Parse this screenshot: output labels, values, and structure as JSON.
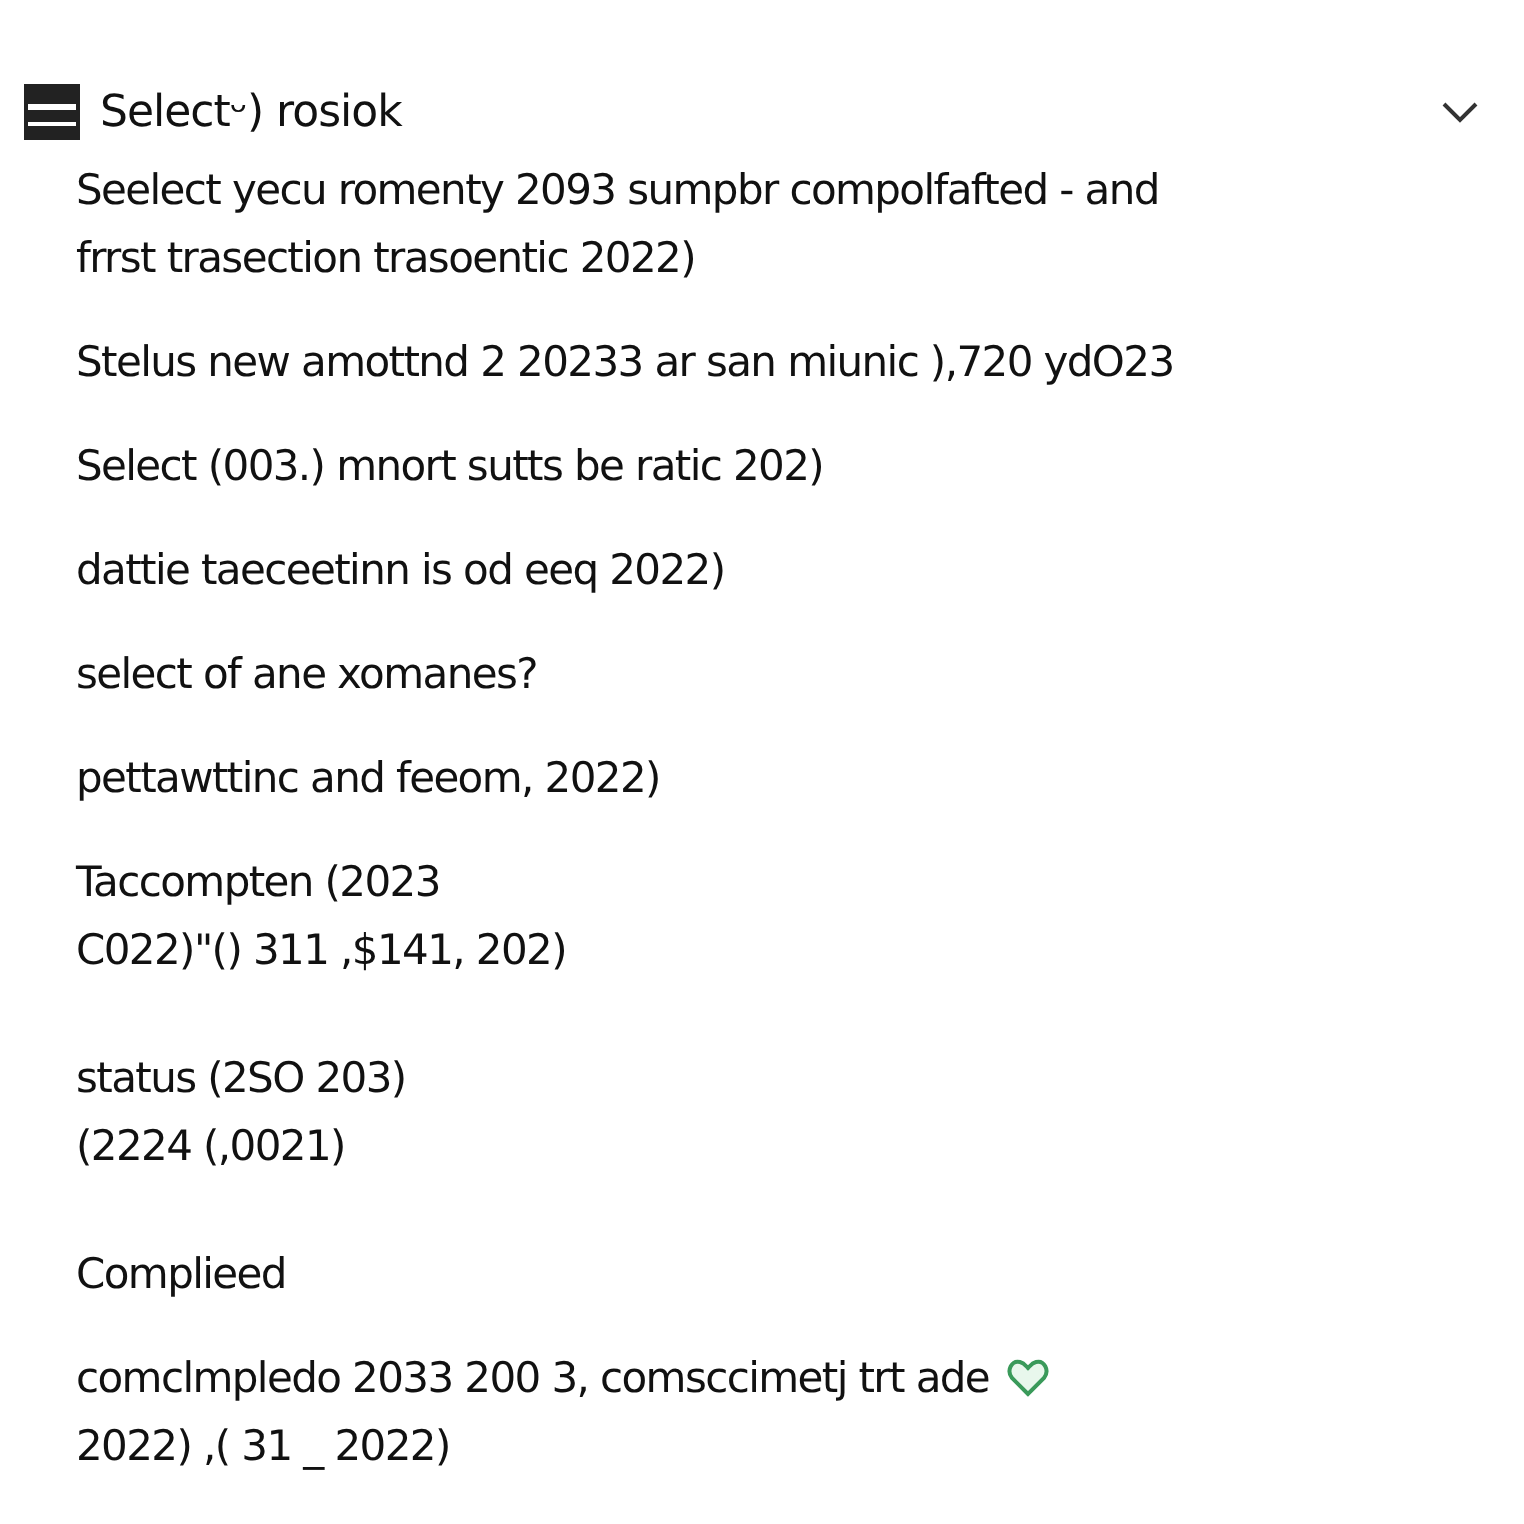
{
  "header": {
    "title": "Selectᵕ) rosiok"
  },
  "blocks": [
    {
      "kind": "text",
      "lines": [
        "Seelect yecu romenty 2093 sumpbr compolfafted - and",
        "frrst trasection trasoentic 2022)"
      ]
    },
    {
      "kind": "text",
      "lines": [
        "Stelus new amottnd 2 20233 ar san miunic ),720 ydO23"
      ]
    },
    {
      "kind": "text",
      "lines": [
        "Select (003.) mnort sutts be ratic 202)"
      ]
    },
    {
      "kind": "text",
      "lines": [
        "dattie taeceetinn is od eeq 2022)"
      ]
    },
    {
      "kind": "text",
      "lines": [
        "select of ane xomanes?"
      ]
    },
    {
      "kind": "text",
      "lines": [
        "pettawttinc and feeom, 2022)"
      ]
    },
    {
      "kind": "text",
      "lines": [
        "Taccompten (2023",
        "C022)\"() 311 ,$141, 202)"
      ]
    },
    {
      "kind": "text",
      "lines": [
        "status (2SO 203)",
        "(2224 (,0021)"
      ]
    },
    {
      "kind": "heading",
      "lines": [
        "Complieed"
      ]
    },
    {
      "kind": "text-heart",
      "lines": [
        "comclmpledo 2033 200 3, comsccimetj trt ade",
        "2022) ,( 31 _ 2022)"
      ]
    }
  ]
}
